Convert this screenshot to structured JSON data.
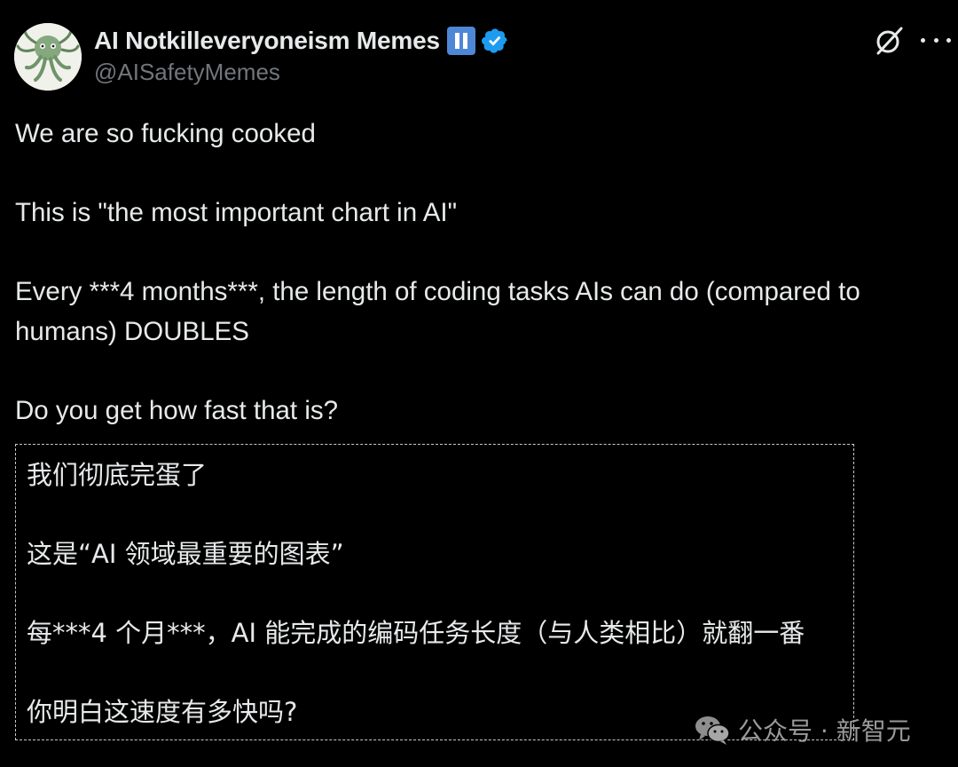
{
  "author": {
    "name": "AI Notkilleveryoneism Memes",
    "handle": "@AISafetyMemes",
    "avatar_icon": "cthulhu-avatar",
    "badges": [
      "pause-icon",
      "verified-icon"
    ],
    "verified_color": "#1d9bf0",
    "pause_badge_color": "#4d87d6"
  },
  "actions": {
    "grok_icon": "grok-icon",
    "more_icon": "more-icon"
  },
  "tweet": {
    "lines": [
      "We are so fucking cooked",
      "This is \"the most important chart in AI\"",
      "Every ***4 months***, the length of coding tasks AIs can do (compared to",
      "humans) DOUBLES",
      "Do you get how fast that is?"
    ]
  },
  "translation": {
    "lines": [
      "我们彻底完蛋了",
      "这是“AI 领域最重要的图表”",
      "每***4 个月***，AI 能完成的编码任务长度（与人类相比）就翻一番",
      "你明白这速度有多快吗?"
    ]
  },
  "watermark": {
    "icon": "wechat-icon",
    "text": "公众号 · 新智元"
  },
  "colors": {
    "background": "#000000",
    "text": "#e7e9ea",
    "muted": "#71767b"
  }
}
